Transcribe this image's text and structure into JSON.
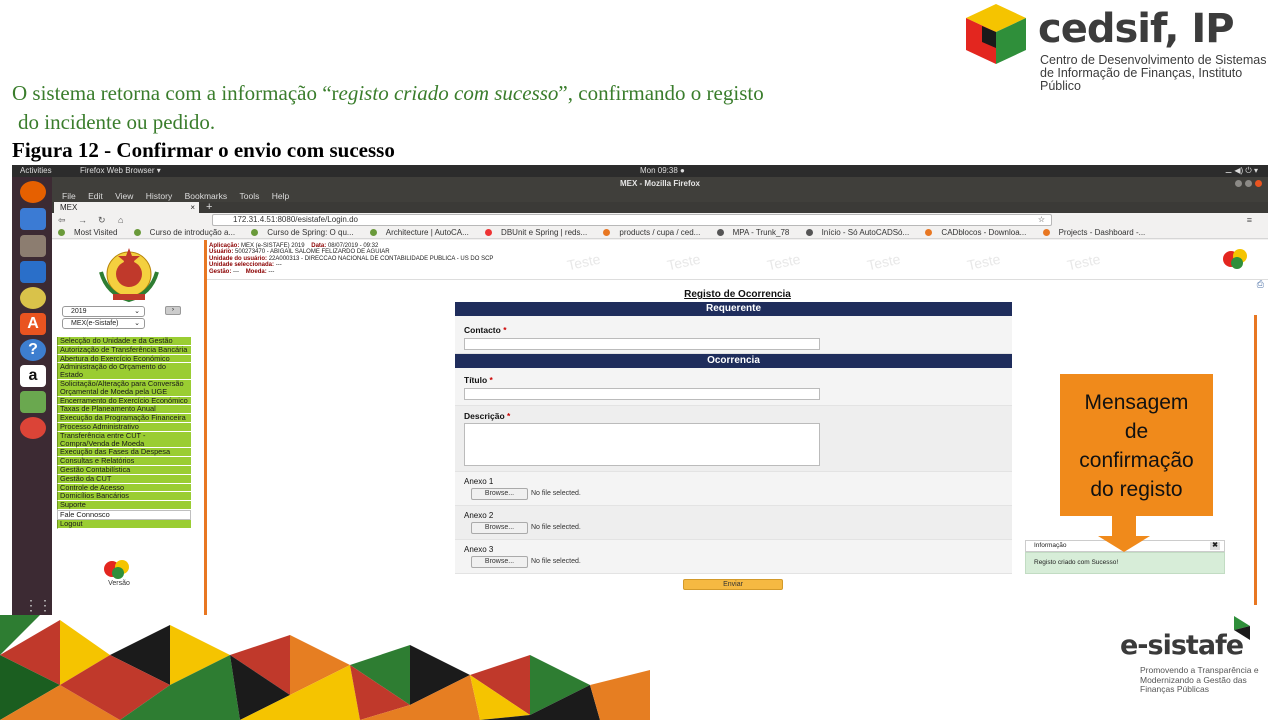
{
  "slide": {
    "caption_part1": "O sistema retorna com a informação “r",
    "caption_italic": "egisto criado com sucesso",
    "caption_part2": "”, confirmando o registo",
    "caption_line2": "do incidente ou pedido.",
    "figure_title": "Figura 12 - Confirmar o envio com sucesso"
  },
  "logo_cedsif": {
    "name": "cedsif, IP",
    "subtitle": "Centro de Desenvolvimento de Sistemas de Informação de Finanças, Instituto Público"
  },
  "logo_esistafe": {
    "name": "e-sistafe",
    "tagline": "Promovendo a Transparência e Modernizando a Gestão das Finanças Públicas"
  },
  "desktop": {
    "activities": "Activities",
    "app_name": "Firefox Web Browser ▾",
    "clock": "Mon 09:38 ●",
    "system_tray": "⚊ ◀) ⏻ ▾",
    "window_title": "MEX - Mozilla Firefox",
    "launcher_icons": [
      "firefox-icon",
      "thunderbird-icon",
      "files-icon",
      "writer-icon",
      "rhythmbox-icon",
      "software-center-icon",
      "help-icon",
      "amazon-icon",
      "editor-icon",
      "chrome-icon"
    ]
  },
  "browser": {
    "menu": [
      "File",
      "Edit",
      "View",
      "History",
      "Bookmarks",
      "Tools",
      "Help"
    ],
    "tab_label": "MEX",
    "url": "172.31.4.51:8080/esistafe/Login.do",
    "bookmarks": [
      "Most Visited",
      "Curso de introdução a...",
      "Curso de Spring: O qu...",
      "Architecture | AutoCA...",
      "DBUnit e Spring | reds...",
      "products / cupa / ced...",
      "MPA - Trunk_78",
      "Início - Só AutoCADSó...",
      "CADblocos - Downloa...",
      "Projects - Dashboard -..."
    ]
  },
  "app": {
    "info": {
      "aplicacao_label": "Aplicação:",
      "aplicacao": "MEX (e-SISTAFE) 2019",
      "data_label": "Data:",
      "data": "08/07/2019 - 09:32",
      "usuario_label": "Usuário:",
      "usuario": "500273470 - ABIGAIL SALOME FELIZARDO DE AGUIAR",
      "unidade_label": "Unidade do usuário:",
      "unidade": "22A000313 - DIRECCAO NACIONAL DE CONTABILIDADE PUBLICA - US DO SCP",
      "unidade_sel_label": "Unidade seleccionada:",
      "unidade_sel": "---",
      "gestao_label": "Gestão:",
      "gestao": "---",
      "moeda_label": "Moeda:",
      "moeda": "---",
      "watermark": "Teste"
    },
    "year_select": "2019",
    "app_select": "MEX(e-Sistafe)",
    "menu": [
      "Selecção do Unidade e da Gestão",
      "Autorização de Transferência Bancária",
      "Abertura do Exercício Económico",
      "Administração do Orçamento do Estado",
      "Solicitação/Alteração para Conversão Orçamental de Moeda pela UGE",
      "Encerramento do Exercício Económico",
      "Taxas de Planeamento Anual",
      "Execução da Programação Financeira",
      "Processo Administrativo",
      "Transferência entre CUT - Compra/Venda de Moeda",
      "Execução das Fases da Despesa",
      "Consultas e Relatórios",
      "Gestão Contabilística",
      "Gestão da CUT",
      "Controle de Acesso",
      "Domicílios Bancários",
      "Suporte",
      "Fale Connosco",
      "Logout"
    ],
    "version_label": "Versão"
  },
  "form": {
    "title": "Registo de Ocorrencia",
    "section_requerente": "Requerente",
    "contacto_label": "Contacto",
    "section_ocorrencia": "Ocorrencia",
    "titulo_label": "Título",
    "descricao_label": "Descrição",
    "required_mark": "*",
    "anexos": [
      {
        "label": "Anexo 1",
        "button": "Browse...",
        "status": "No file selected."
      },
      {
        "label": "Anexo 2",
        "button": "Browse...",
        "status": "No file selected."
      },
      {
        "label": "Anexo 3",
        "button": "Browse...",
        "status": "No file selected."
      }
    ],
    "submit": "Enviar"
  },
  "notification": {
    "header": "Informação",
    "close": "✖",
    "message": "Registo criado com Sucesso!"
  },
  "callout": {
    "text_lines": [
      "Mensagem",
      "de",
      "confirmação",
      "do registo"
    ]
  },
  "colors": {
    "caption_green": "#3a7d2c",
    "menu_green": "#9acd32",
    "section_navy": "#1f2d5c",
    "callout_orange": "#f08a1b",
    "notification_green": "#d7edd8"
  }
}
